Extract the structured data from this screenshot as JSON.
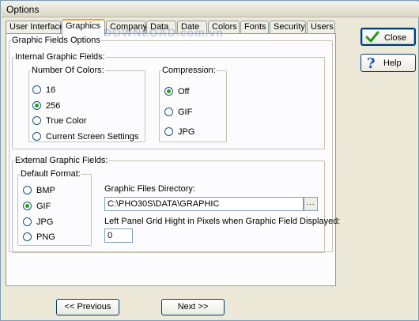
{
  "window": {
    "title": "Options"
  },
  "tabs": [
    {
      "label": "User Interface",
      "active": false
    },
    {
      "label": "Graphics",
      "active": true
    },
    {
      "label": "Company",
      "active": false
    },
    {
      "label": "Data",
      "active": false
    },
    {
      "label": "Date",
      "active": false
    },
    {
      "label": "Colors",
      "active": false
    },
    {
      "label": "Fonts",
      "active": false
    },
    {
      "label": "Security",
      "active": false
    },
    {
      "label": "Users",
      "active": false
    }
  ],
  "graphic_fields": {
    "label": "Graphic Fields Options",
    "internal": {
      "label": "Internal Graphic Fields:",
      "colors": {
        "label": "Number Of Colors:",
        "options": [
          "16",
          "256",
          "True Color",
          "Current Screen Settings"
        ],
        "selected": "256"
      },
      "compression": {
        "label": "Compression:",
        "options": [
          "Off",
          "GIF",
          "JPG"
        ],
        "selected": "Off"
      }
    },
    "external": {
      "label": "External Graphic Fields:",
      "format": {
        "label": "Default Format:",
        "options": [
          "BMP",
          "GIF",
          "JPG",
          "PNG"
        ],
        "selected": "GIF"
      },
      "directory_label": "Graphic Files Directory:",
      "directory_value": "C:\\PHO30S\\DATA\\GRAPHIC",
      "browse_label": "...",
      "grid_height_label": "Left Panel Grid Hight in Pixels when Graphic Field Displayed:",
      "grid_height_value": "0"
    }
  },
  "buttons": {
    "close": "Close",
    "help": "Help",
    "previous": "<< Previous",
    "next": "Next >>"
  },
  "watermark": "DOWNLOAD.com.vn",
  "colors": {
    "tab_highlight": "#f2a33a",
    "radio_dot": "#21a121",
    "close_check": "#1f9a1f",
    "help_mark": "#1d4fb5"
  }
}
